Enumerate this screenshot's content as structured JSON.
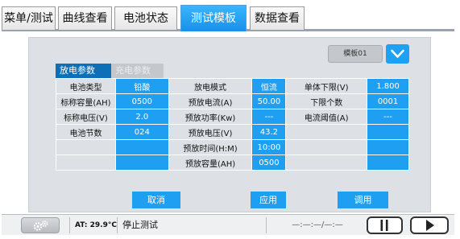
{
  "tabs": [
    {
      "label": "菜单/测试",
      "active": false
    },
    {
      "label": "曲线查看",
      "active": false
    },
    {
      "label": "电池状态",
      "active": false
    },
    {
      "label": "测试模板",
      "active": true
    },
    {
      "label": "数据查看",
      "active": false
    }
  ],
  "template_selector": {
    "value": "模板01"
  },
  "subtabs": {
    "discharge": "放电参数",
    "charge": "充电参数"
  },
  "params": {
    "battery_type_label": "电池类型",
    "battery_type": "铅酸",
    "discharge_mode_label": "放电模式",
    "discharge_mode": "恒流",
    "cell_lower_limit_label": "单体下限(V)",
    "cell_lower_limit": "1.800",
    "nominal_capacity_label": "标称容量(AH)",
    "nominal_capacity": "0500",
    "pre_discharge_current_label": "预放电流(A)",
    "pre_discharge_current": "50.00",
    "lower_limit_count_label": "下限个数",
    "lower_limit_count": "0001",
    "nominal_voltage_label": "标称电压(V)",
    "nominal_voltage": "2.0",
    "pre_discharge_power_label": "预放功率(Kw)",
    "pre_discharge_power": "---",
    "current_threshold_label": "电流阈值(A)",
    "current_threshold": "---",
    "cell_count_label": "电池节数",
    "cell_count": "024",
    "pre_discharge_voltage_label": "预放电压(V)",
    "pre_discharge_voltage": "43.2",
    "pre_discharge_time_label": "预放时间(H:M)",
    "pre_discharge_time": "10:00",
    "pre_discharge_capacity_label": "预放容量(AH)",
    "pre_discharge_capacity": "0500"
  },
  "buttons": {
    "cancel": "取消",
    "apply": "应用",
    "load": "调用"
  },
  "statusbar": {
    "temperature": "AT: 29.9°C",
    "status": "停止测试",
    "time": "—:—:—/—:—"
  },
  "colors": {
    "accent": "#1e9ff2",
    "tab_active": "#1a8fe6",
    "subtab_active": "#0d6fb8"
  }
}
